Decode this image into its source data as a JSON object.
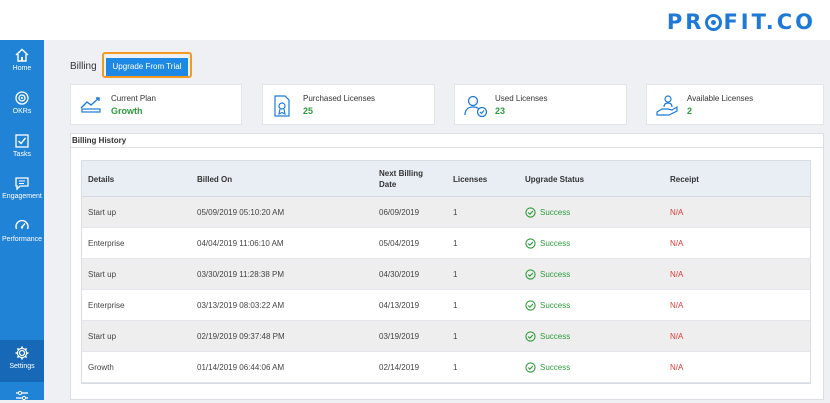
{
  "brand": {
    "logo_prefix": "PR",
    "logo_suffix": "FIT.CO",
    "color": "#1e7ad6"
  },
  "sidebar": {
    "items": [
      {
        "label": "Home",
        "icon": "home-icon"
      },
      {
        "label": "OKRs",
        "icon": "target-icon"
      },
      {
        "label": "Tasks",
        "icon": "checkbox-icon"
      },
      {
        "label": "Engagement",
        "icon": "chat-icon"
      },
      {
        "label": "Performance",
        "icon": "gauge-icon"
      },
      {
        "label": "Settings",
        "icon": "gear-icon",
        "active": true
      }
    ]
  },
  "page": {
    "title": "Billing",
    "upgrade_button": "Upgrade From Trial"
  },
  "cards": [
    {
      "title": "Current Plan",
      "value": "Growth",
      "icon": "plan-icon"
    },
    {
      "title": "Purchased Licenses",
      "value": "25",
      "icon": "certificate-icon"
    },
    {
      "title": "Used Licenses",
      "value": "23",
      "icon": "user-check-icon"
    },
    {
      "title": "Available Licenses",
      "value": "2",
      "icon": "hand-user-icon"
    }
  ],
  "history": {
    "title": "Billing History",
    "columns": [
      "Details",
      "Billed On",
      "Next Billing Date",
      "Licenses",
      "Upgrade Status",
      "Receipt"
    ],
    "rows": [
      {
        "details": "Start up",
        "billed_on": "05/09/2019 05:10:20 AM",
        "next": "06/09/2019",
        "licenses": "1",
        "status": "Success",
        "receipt": "N/A"
      },
      {
        "details": "Enterprise",
        "billed_on": "04/04/2019 11:06:10 AM",
        "next": "05/04/2019",
        "licenses": "1",
        "status": "Success",
        "receipt": "N/A"
      },
      {
        "details": "Start up",
        "billed_on": "03/30/2019 11:28:38 PM",
        "next": "04/30/2019",
        "licenses": "1",
        "status": "Success",
        "receipt": "N/A"
      },
      {
        "details": "Enterprise",
        "billed_on": "03/13/2019 08:03:22 AM",
        "next": "04/13/2019",
        "licenses": "1",
        "status": "Success",
        "receipt": "N/A"
      },
      {
        "details": "Start up",
        "billed_on": "02/19/2019 09:37:48 PM",
        "next": "03/19/2019",
        "licenses": "1",
        "status": "Success",
        "receipt": "N/A"
      },
      {
        "details": "Growth",
        "billed_on": "01/14/2019 06:44:06 AM",
        "next": "02/14/2019",
        "licenses": "1",
        "status": "Success",
        "receipt": "N/A"
      }
    ]
  },
  "colors": {
    "sidebar": "#2183d6",
    "success": "#2e9b3c",
    "na": "#e53935",
    "highlight": "#f39a23"
  }
}
